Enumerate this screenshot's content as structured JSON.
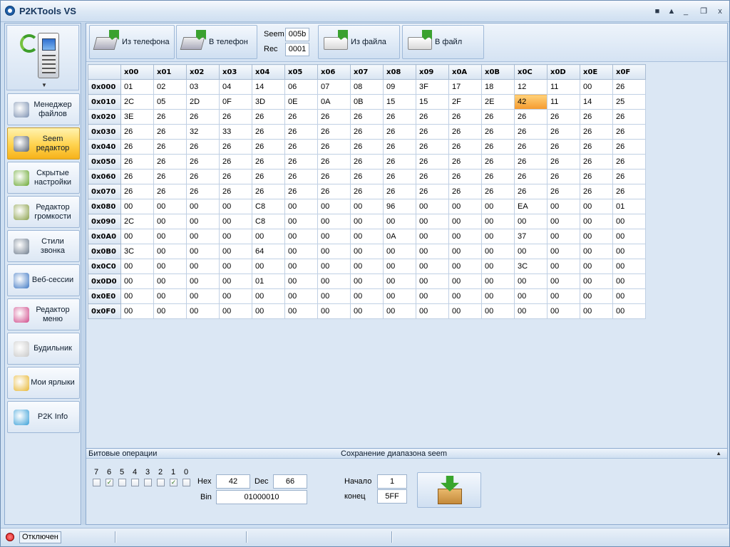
{
  "window": {
    "title": "P2KTools VS",
    "controls": [
      "■",
      "▲",
      "_",
      "❐",
      "x"
    ]
  },
  "sidebar": {
    "items": [
      {
        "label": "Менеджер файлов",
        "icon": "file-manager-icon",
        "active": false
      },
      {
        "label": "Seem редактор",
        "icon": "seem-editor-icon",
        "active": true
      },
      {
        "label": "Скрытые настройки",
        "icon": "hidden-settings-icon",
        "active": false
      },
      {
        "label": "Редактор громкости",
        "icon": "volume-editor-icon",
        "active": false
      },
      {
        "label": "Стили звонка",
        "icon": "ring-styles-icon",
        "active": false
      },
      {
        "label": "Веб-сессии",
        "icon": "web-sessions-icon",
        "active": false
      },
      {
        "label": "Редактор меню",
        "icon": "menu-editor-icon",
        "active": false
      },
      {
        "label": "Будильник",
        "icon": "alarm-clock-icon",
        "active": false
      },
      {
        "label": "Мои ярлыки",
        "icon": "shortcuts-icon",
        "active": false
      },
      {
        "label": "P2K Info",
        "icon": "p2k-info-icon",
        "active": false
      }
    ]
  },
  "toolbar": {
    "from_phone_label": "Из телефона",
    "to_phone_label": "В телефон",
    "seem_label": "Seem",
    "seem_value": "005b",
    "rec_label": "Rec",
    "rec_value": "0001",
    "from_file_label": "Из файла",
    "to_file_label": "В файл"
  },
  "table": {
    "columns": [
      "x00",
      "x01",
      "x02",
      "x03",
      "x04",
      "x05",
      "x06",
      "x07",
      "x08",
      "x09",
      "x0A",
      "x0B",
      "x0C",
      "x0D",
      "x0E",
      "x0F"
    ],
    "selected": {
      "row": 1,
      "col": 12
    },
    "rows": [
      {
        "addr": "0x000",
        "cells": [
          "01",
          "02",
          "03",
          "04",
          "14",
          "06",
          "07",
          "08",
          "09",
          "3F",
          "17",
          "18",
          "12",
          "11",
          "00",
          "26"
        ]
      },
      {
        "addr": "0x010",
        "cells": [
          "2C",
          "05",
          "2D",
          "0F",
          "3D",
          "0E",
          "0A",
          "0B",
          "15",
          "15",
          "2F",
          "2E",
          "42",
          "11",
          "14",
          "25"
        ]
      },
      {
        "addr": "0x020",
        "cells": [
          "3E",
          "26",
          "26",
          "26",
          "26",
          "26",
          "26",
          "26",
          "26",
          "26",
          "26",
          "26",
          "26",
          "26",
          "26",
          "26"
        ]
      },
      {
        "addr": "0x030",
        "cells": [
          "26",
          "26",
          "32",
          "33",
          "26",
          "26",
          "26",
          "26",
          "26",
          "26",
          "26",
          "26",
          "26",
          "26",
          "26",
          "26"
        ]
      },
      {
        "addr": "0x040",
        "cells": [
          "26",
          "26",
          "26",
          "26",
          "26",
          "26",
          "26",
          "26",
          "26",
          "26",
          "26",
          "26",
          "26",
          "26",
          "26",
          "26"
        ]
      },
      {
        "addr": "0x050",
        "cells": [
          "26",
          "26",
          "26",
          "26",
          "26",
          "26",
          "26",
          "26",
          "26",
          "26",
          "26",
          "26",
          "26",
          "26",
          "26",
          "26"
        ]
      },
      {
        "addr": "0x060",
        "cells": [
          "26",
          "26",
          "26",
          "26",
          "26",
          "26",
          "26",
          "26",
          "26",
          "26",
          "26",
          "26",
          "26",
          "26",
          "26",
          "26"
        ]
      },
      {
        "addr": "0x070",
        "cells": [
          "26",
          "26",
          "26",
          "26",
          "26",
          "26",
          "26",
          "26",
          "26",
          "26",
          "26",
          "26",
          "26",
          "26",
          "26",
          "26"
        ]
      },
      {
        "addr": "0x080",
        "cells": [
          "00",
          "00",
          "00",
          "00",
          "C8",
          "00",
          "00",
          "00",
          "96",
          "00",
          "00",
          "00",
          "EA",
          "00",
          "00",
          "01"
        ]
      },
      {
        "addr": "0x090",
        "cells": [
          "2C",
          "00",
          "00",
          "00",
          "C8",
          "00",
          "00",
          "00",
          "00",
          "00",
          "00",
          "00",
          "00",
          "00",
          "00",
          "00"
        ]
      },
      {
        "addr": "0x0A0",
        "cells": [
          "00",
          "00",
          "00",
          "00",
          "00",
          "00",
          "00",
          "00",
          "0A",
          "00",
          "00",
          "00",
          "37",
          "00",
          "00",
          "00"
        ]
      },
      {
        "addr": "0x0B0",
        "cells": [
          "3C",
          "00",
          "00",
          "00",
          "64",
          "00",
          "00",
          "00",
          "00",
          "00",
          "00",
          "00",
          "00",
          "00",
          "00",
          "00"
        ]
      },
      {
        "addr": "0x0C0",
        "cells": [
          "00",
          "00",
          "00",
          "00",
          "00",
          "00",
          "00",
          "00",
          "00",
          "00",
          "00",
          "00",
          "3C",
          "00",
          "00",
          "00"
        ]
      },
      {
        "addr": "0x0D0",
        "cells": [
          "00",
          "00",
          "00",
          "00",
          "01",
          "00",
          "00",
          "00",
          "00",
          "00",
          "00",
          "00",
          "00",
          "00",
          "00",
          "00"
        ]
      },
      {
        "addr": "0x0E0",
        "cells": [
          "00",
          "00",
          "00",
          "00",
          "00",
          "00",
          "00",
          "00",
          "00",
          "00",
          "00",
          "00",
          "00",
          "00",
          "00",
          "00"
        ]
      },
      {
        "addr": "0x0F0",
        "cells": [
          "00",
          "00",
          "00",
          "00",
          "00",
          "00",
          "00",
          "00",
          "00",
          "00",
          "00",
          "00",
          "00",
          "00",
          "00",
          "00"
        ]
      }
    ]
  },
  "bottom": {
    "bits_title": "Битовые операции",
    "save_title": "Сохранение диапазона seem",
    "bits": [
      {
        "num": "7",
        "checked": false
      },
      {
        "num": "6",
        "checked": true
      },
      {
        "num": "5",
        "checked": false
      },
      {
        "num": "4",
        "checked": false
      },
      {
        "num": "3",
        "checked": false
      },
      {
        "num": "2",
        "checked": false
      },
      {
        "num": "1",
        "checked": true
      },
      {
        "num": "0",
        "checked": false
      }
    ],
    "hex_label": "Hex",
    "hex_value": "42",
    "dec_label": "Dec",
    "dec_value": "66",
    "bin_label": "Bin",
    "bin_value": "01000010",
    "start_label": "Начало",
    "start_value": "1",
    "end_label": "конец",
    "end_value": "5FF"
  },
  "status": {
    "text": "Отключен",
    "indicator_color": "#e02020"
  }
}
